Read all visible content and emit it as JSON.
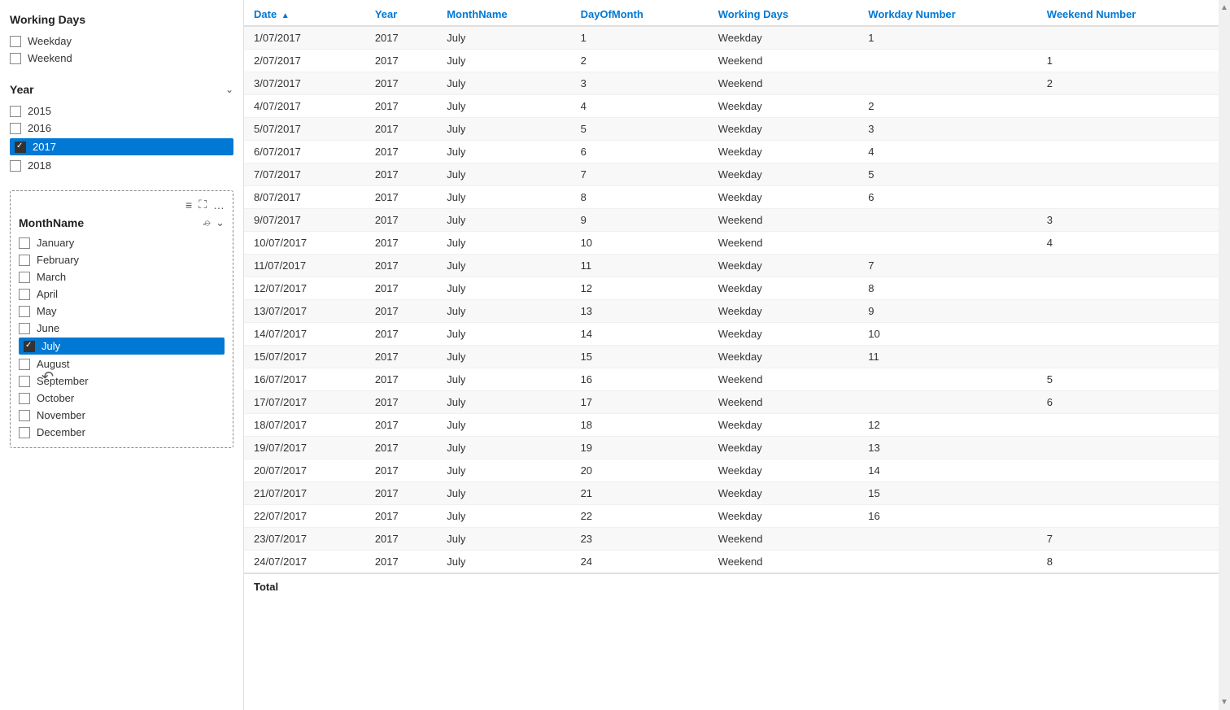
{
  "sidebar": {
    "working_days_title": "Working Days",
    "working_days_options": [
      {
        "label": "Weekday",
        "checked": false
      },
      {
        "label": "Weekend",
        "checked": false
      }
    ],
    "year_filter": {
      "title": "Year",
      "years": [
        {
          "value": "2015",
          "checked": false,
          "selected": false
        },
        {
          "value": "2016",
          "checked": false,
          "selected": false
        },
        {
          "value": "2017",
          "checked": true,
          "selected": true
        },
        {
          "value": "2018",
          "checked": false,
          "selected": false
        }
      ]
    },
    "month_slicer": {
      "title": "MonthName",
      "months": [
        {
          "label": "January",
          "checked": false,
          "selected": false
        },
        {
          "label": "February",
          "checked": false,
          "selected": false
        },
        {
          "label": "March",
          "checked": false,
          "selected": false
        },
        {
          "label": "April",
          "checked": false,
          "selected": false
        },
        {
          "label": "May",
          "checked": false,
          "selected": false
        },
        {
          "label": "June",
          "checked": false,
          "selected": false
        },
        {
          "label": "July",
          "checked": true,
          "selected": true
        },
        {
          "label": "August",
          "checked": false,
          "selected": false,
          "hover": true
        },
        {
          "label": "September",
          "checked": false,
          "selected": false
        },
        {
          "label": "October",
          "checked": false,
          "selected": false
        },
        {
          "label": "November",
          "checked": false,
          "selected": false
        },
        {
          "label": "December",
          "checked": false,
          "selected": false
        }
      ]
    }
  },
  "table": {
    "columns": [
      {
        "key": "date",
        "label": "Date",
        "sorted": true
      },
      {
        "key": "year",
        "label": "Year"
      },
      {
        "key": "monthName",
        "label": "MonthName"
      },
      {
        "key": "dayOfMonth",
        "label": "DayOfMonth"
      },
      {
        "key": "workingDays",
        "label": "Working Days"
      },
      {
        "key": "workdayNumber",
        "label": "Workday Number"
      },
      {
        "key": "weekendNumber",
        "label": "Weekend Number"
      }
    ],
    "rows": [
      {
        "date": "1/07/2017",
        "year": "2017",
        "monthName": "July",
        "dayOfMonth": "1",
        "workingDays": "Weekday",
        "workdayNumber": "1",
        "weekendNumber": ""
      },
      {
        "date": "2/07/2017",
        "year": "2017",
        "monthName": "July",
        "dayOfMonth": "2",
        "workingDays": "Weekend",
        "workdayNumber": "",
        "weekendNumber": "1"
      },
      {
        "date": "3/07/2017",
        "year": "2017",
        "monthName": "July",
        "dayOfMonth": "3",
        "workingDays": "Weekend",
        "workdayNumber": "",
        "weekendNumber": "2"
      },
      {
        "date": "4/07/2017",
        "year": "2017",
        "monthName": "July",
        "dayOfMonth": "4",
        "workingDays": "Weekday",
        "workdayNumber": "2",
        "weekendNumber": ""
      },
      {
        "date": "5/07/2017",
        "year": "2017",
        "monthName": "July",
        "dayOfMonth": "5",
        "workingDays": "Weekday",
        "workdayNumber": "3",
        "weekendNumber": ""
      },
      {
        "date": "6/07/2017",
        "year": "2017",
        "monthName": "July",
        "dayOfMonth": "6",
        "workingDays": "Weekday",
        "workdayNumber": "4",
        "weekendNumber": ""
      },
      {
        "date": "7/07/2017",
        "year": "2017",
        "monthName": "July",
        "dayOfMonth": "7",
        "workingDays": "Weekday",
        "workdayNumber": "5",
        "weekendNumber": ""
      },
      {
        "date": "8/07/2017",
        "year": "2017",
        "monthName": "July",
        "dayOfMonth": "8",
        "workingDays": "Weekday",
        "workdayNumber": "6",
        "weekendNumber": ""
      },
      {
        "date": "9/07/2017",
        "year": "2017",
        "monthName": "July",
        "dayOfMonth": "9",
        "workingDays": "Weekend",
        "workdayNumber": "",
        "weekendNumber": "3"
      },
      {
        "date": "10/07/2017",
        "year": "2017",
        "monthName": "July",
        "dayOfMonth": "10",
        "workingDays": "Weekend",
        "workdayNumber": "",
        "weekendNumber": "4"
      },
      {
        "date": "11/07/2017",
        "year": "2017",
        "monthName": "July",
        "dayOfMonth": "11",
        "workingDays": "Weekday",
        "workdayNumber": "7",
        "weekendNumber": ""
      },
      {
        "date": "12/07/2017",
        "year": "2017",
        "monthName": "July",
        "dayOfMonth": "12",
        "workingDays": "Weekday",
        "workdayNumber": "8",
        "weekendNumber": ""
      },
      {
        "date": "13/07/2017",
        "year": "2017",
        "monthName": "July",
        "dayOfMonth": "13",
        "workingDays": "Weekday",
        "workdayNumber": "9",
        "weekendNumber": ""
      },
      {
        "date": "14/07/2017",
        "year": "2017",
        "monthName": "July",
        "dayOfMonth": "14",
        "workingDays": "Weekday",
        "workdayNumber": "10",
        "weekendNumber": ""
      },
      {
        "date": "15/07/2017",
        "year": "2017",
        "monthName": "July",
        "dayOfMonth": "15",
        "workingDays": "Weekday",
        "workdayNumber": "11",
        "weekendNumber": ""
      },
      {
        "date": "16/07/2017",
        "year": "2017",
        "monthName": "July",
        "dayOfMonth": "16",
        "workingDays": "Weekend",
        "workdayNumber": "",
        "weekendNumber": "5"
      },
      {
        "date": "17/07/2017",
        "year": "2017",
        "monthName": "July",
        "dayOfMonth": "17",
        "workingDays": "Weekend",
        "workdayNumber": "",
        "weekendNumber": "6"
      },
      {
        "date": "18/07/2017",
        "year": "2017",
        "monthName": "July",
        "dayOfMonth": "18",
        "workingDays": "Weekday",
        "workdayNumber": "12",
        "weekendNumber": ""
      },
      {
        "date": "19/07/2017",
        "year": "2017",
        "monthName": "July",
        "dayOfMonth": "19",
        "workingDays": "Weekday",
        "workdayNumber": "13",
        "weekendNumber": ""
      },
      {
        "date": "20/07/2017",
        "year": "2017",
        "monthName": "July",
        "dayOfMonth": "20",
        "workingDays": "Weekday",
        "workdayNumber": "14",
        "weekendNumber": ""
      },
      {
        "date": "21/07/2017",
        "year": "2017",
        "monthName": "July",
        "dayOfMonth": "21",
        "workingDays": "Weekday",
        "workdayNumber": "15",
        "weekendNumber": ""
      },
      {
        "date": "22/07/2017",
        "year": "2017",
        "monthName": "July",
        "dayOfMonth": "22",
        "workingDays": "Weekday",
        "workdayNumber": "16",
        "weekendNumber": ""
      },
      {
        "date": "23/07/2017",
        "year": "2017",
        "monthName": "July",
        "dayOfMonth": "23",
        "workingDays": "Weekend",
        "workdayNumber": "",
        "weekendNumber": "7"
      },
      {
        "date": "24/07/2017",
        "year": "2017",
        "monthName": "July",
        "dayOfMonth": "24",
        "workingDays": "Weekend",
        "workdayNumber": "",
        "weekendNumber": "8"
      }
    ],
    "footer_label": "Total"
  }
}
